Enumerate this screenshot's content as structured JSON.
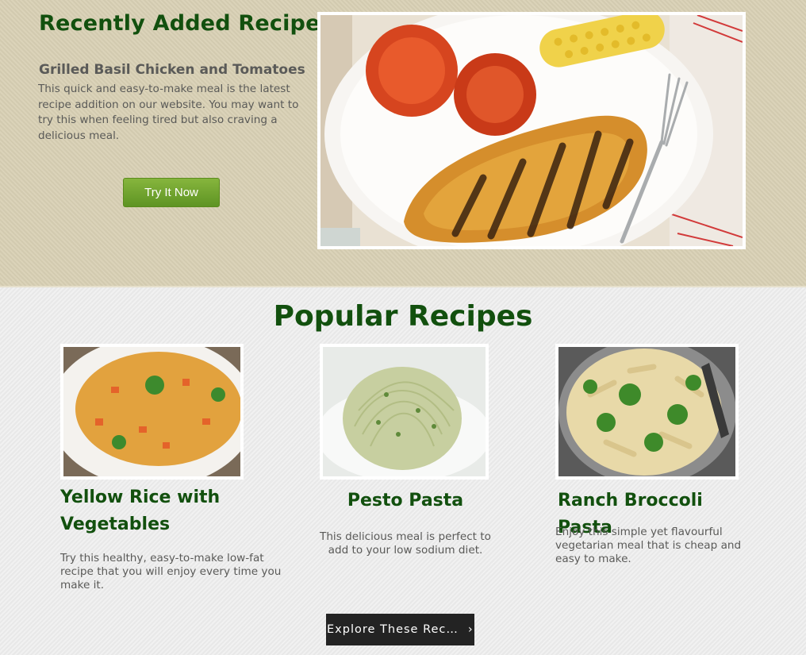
{
  "hero": {
    "title": "Recently Added Recipes",
    "recipe_name": "Grilled Basil Chicken and Tomatoes",
    "description": "This quick and easy-to-make meal is the latest recipe addition on our website. You may want to try this when feeling tired but also craving a delicious meal.",
    "button_label": "Try It Now",
    "image": "grilled-chicken-photo"
  },
  "popular": {
    "title": "Popular Recipes",
    "cards": [
      {
        "title": "Yellow Rice with Vegetables",
        "description": "Try this healthy, easy-to-make low-fat recipe that you will enjoy every time you make it.",
        "image": "yellow-rice-photo"
      },
      {
        "title": "Pesto Pasta",
        "description": "This delicious meal is perfect to add to your low sodium diet.",
        "image": "pesto-pasta-photo"
      },
      {
        "title": "Ranch Broccoli Pasta",
        "description": "Enjoy this simple yet flavourful vegetarian meal that is cheap and easy to make.",
        "image": "broccoli-pasta-photo"
      }
    ],
    "explore_button_label": "Explore These Recipes"
  },
  "colors": {
    "heading_green": "#12500e",
    "button_green": "#6fa22e",
    "hero_bg": "#d9d1b5",
    "dark_button": "#232323"
  }
}
